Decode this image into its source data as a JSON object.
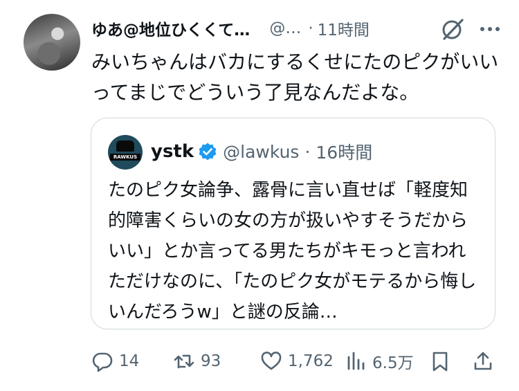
{
  "post": {
    "display_name": "ゆあ@地位ひくくて…",
    "handle": "@…",
    "dot": "·",
    "time": "11時間",
    "text": "みいちゃんはバカにするくせにたのピクがいいってまじでどういう了見なんだよな。"
  },
  "quote": {
    "avatar_text": "RAWKUS",
    "name": "ystk",
    "handle": "@lawkus",
    "dot": "·",
    "time": "16時間",
    "text": "たのピク女論争、露骨に言い直せば「軽度知的障害くらいの女の方が扱いやすそうだからいい」とか言ってる男たちがキモっと言われただけなのに、「たのピク女がモテるから悔しいんだろうw」と謎の反論…"
  },
  "actions": {
    "replies": "14",
    "reposts": "93",
    "likes": "1,762",
    "views": "6.5万"
  },
  "icons": {
    "grok": "grok-icon",
    "more": "more-icon",
    "verified": "verified-badge-icon",
    "reply": "reply-icon",
    "repost": "repost-icon",
    "like": "heart-icon",
    "views": "views-chart-icon",
    "bookmark": "bookmark-icon",
    "share": "share-icon"
  },
  "colors": {
    "text": "#0f1419",
    "secondary": "#536471",
    "border": "#cfd9de",
    "verified": "#1d9bf0"
  }
}
